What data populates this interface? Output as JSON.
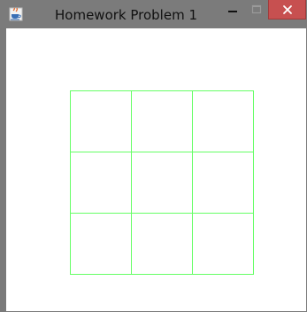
{
  "window": {
    "title": "Homework Problem 1",
    "controls": {
      "minimize": "minimize-icon",
      "maximize": "maximize-icon",
      "close": "close-icon"
    },
    "app_icon": "java-cup-icon"
  },
  "grid": {
    "rows": 3,
    "columns": 3,
    "line_color": "#66ff66"
  },
  "colors": {
    "titlebar": "#7b7b7b",
    "close_button": "#c75050",
    "client_background": "#ffffff"
  }
}
